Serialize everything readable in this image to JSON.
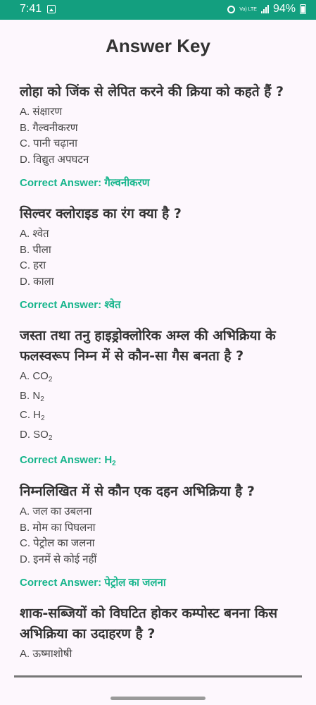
{
  "status_bar": {
    "time": "7:41",
    "volte": "Vo) LTE",
    "battery_text": "94%"
  },
  "page_title": "Answer Key",
  "correct_prefix": "Correct Answer:",
  "questions": [
    {
      "question": "लोहा को जिंक से लेपित करने की क्रिया को कहते हैं ?",
      "options": [
        "A. संक्षारण",
        "B. गैल्वनीकरण",
        "C. पानी चढ़ाना",
        "D. विद्युत अपघटन"
      ],
      "answer": "गैल्वनीकरण"
    },
    {
      "question": "सिल्वर क्लोराइड का रंग क्या है ?",
      "options": [
        "A. श्वेत",
        "B. पीला",
        "C. हरा",
        "D. काला"
      ],
      "answer": "श्वेत"
    },
    {
      "question": "जस्ता तथा तनु हाइड्रोक्लोरिक अम्ल की अभिक्रिया के फलस्वरूप निम्न में से कौन-सा गैस बनता है ?",
      "options": [
        "A. CO₂",
        "B. N₂",
        "C. H₂",
        "D. SO₂"
      ],
      "answer": "H₂"
    },
    {
      "question": "निम्नलिखित में से कौन एक दहन अभिक्रिया है ?",
      "options": [
        "A. जल का उबलना",
        "B. मोम का पिघलना",
        "C. पेट्रोल का जलना",
        "D. इनमें से कोई नहीं"
      ],
      "answer": "पेट्रोल का जलना"
    },
    {
      "question": "शाक-सब्जियों को विघटित होकर कम्पोस्ट बनना किस अभिक्रिया का उदाहरण है ?",
      "options": [
        "A. ऊष्माशोषी"
      ],
      "answer": ""
    }
  ]
}
